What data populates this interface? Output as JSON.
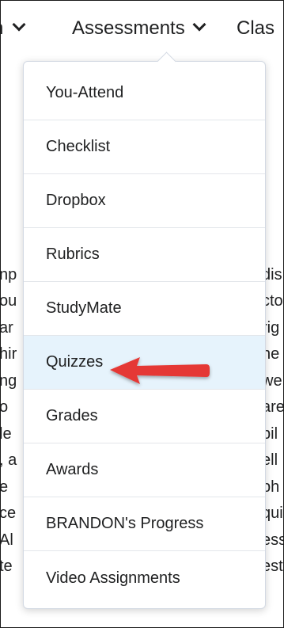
{
  "nav": {
    "prev_label": "n",
    "assessments_label": "Assessments",
    "next_label": "Clas"
  },
  "background_text": {
    "left": [
      "np",
      "ou",
      "ar",
      "hir",
      "ng",
      "o",
      "le",
      ", a",
      "e",
      "ce",
      "Al",
      "te"
    ],
    "right": [
      "dis",
      "cto",
      "rig",
      "he",
      "we",
      "are",
      "bil",
      "ell",
      "ph",
      "qui",
      "ess",
      "est"
    ]
  },
  "menu": {
    "items": [
      {
        "label": "You-Attend"
      },
      {
        "label": "Checklist"
      },
      {
        "label": "Dropbox"
      },
      {
        "label": "Rubrics"
      },
      {
        "label": "StudyMate"
      },
      {
        "label": "Quizzes"
      },
      {
        "label": "Grades"
      },
      {
        "label": "Awards"
      },
      {
        "label": "BRANDON's Progress"
      },
      {
        "label": "Video Assignments"
      }
    ],
    "active_index": 5
  },
  "colors": {
    "active_bg": "#e6f3fc",
    "arrow": "#e53935"
  }
}
